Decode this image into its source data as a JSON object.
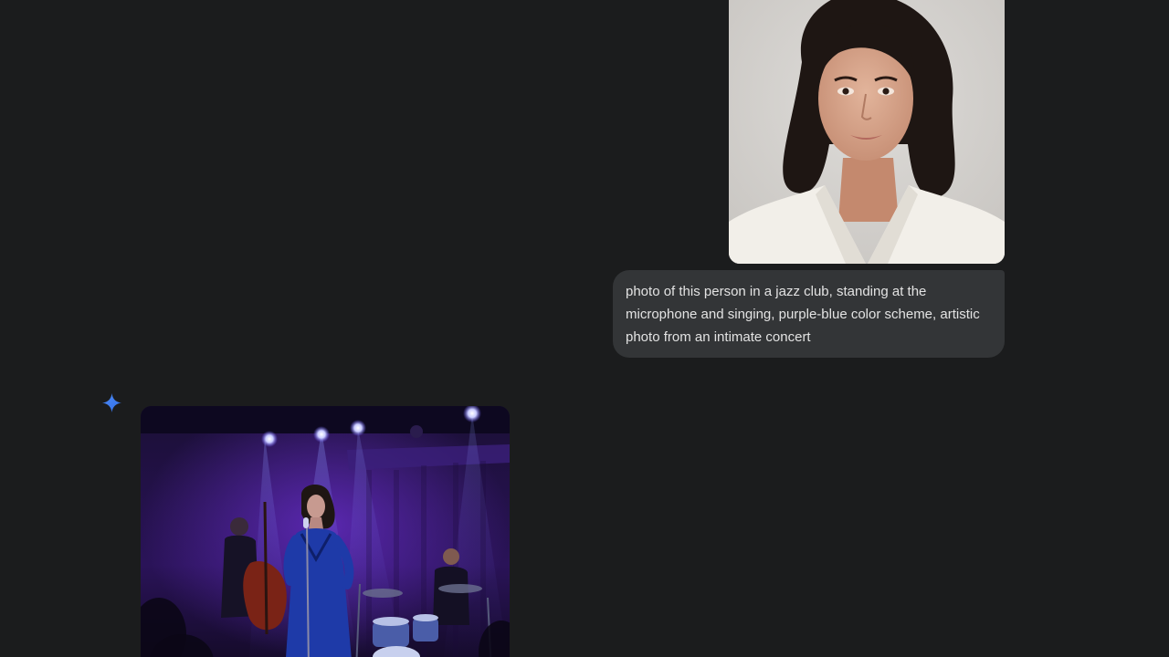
{
  "conversation": {
    "user_turn": {
      "image": {
        "alt": "portrait-photo",
        "colors": {
          "background": "#d9d7d4",
          "hair": "#1e1613",
          "skin": "#d6a48a",
          "blazer": "#f2efe9"
        }
      },
      "prompt_text": "photo of this person in a jazz club, standing at the microphone and singing, purple-blue color scheme, artistic photo from an intimate concert"
    },
    "model_turn": {
      "avatar_icon": "gemini-spark-icon",
      "image": {
        "alt": "generated-jazz-club-photo",
        "colors": {
          "stage_dark": "#140a2a",
          "purple_light": "#6b2fd0",
          "blue_light": "#3a4fe0",
          "dress": "#1e3aa8"
        }
      }
    }
  },
  "theme": {
    "page_background": "#1b1c1d",
    "bubble_background": "#333537",
    "bubble_text": "#e3e3e3",
    "accent_blue": "#4285f4"
  }
}
